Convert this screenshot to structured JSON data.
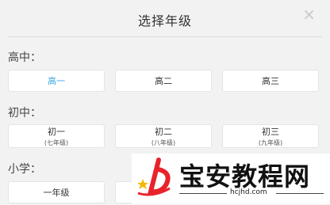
{
  "dialog": {
    "title": "选择年级",
    "close_glyph": "×"
  },
  "sections": {
    "high": {
      "label": "高中：",
      "options": [
        {
          "main": "高一",
          "selected": true
        },
        {
          "main": "高二"
        },
        {
          "main": "高三"
        }
      ]
    },
    "middle": {
      "label": "初中：",
      "options": [
        {
          "main": "初一",
          "sub": "(七年级)"
        },
        {
          "main": "初二",
          "sub": "(八年级)"
        },
        {
          "main": "初三",
          "sub": "(九年级)"
        }
      ]
    },
    "primary": {
      "label": "小学：",
      "options": [
        {
          "main": "一年级"
        }
      ]
    }
  },
  "watermark": {
    "text": "宝安教程网",
    "url": "hcjhd.com",
    "colors": {
      "logo_red": "#e8232c",
      "logo_star": "#f5b800"
    }
  },
  "colors": {
    "accent": "#3fa7e6",
    "background": "#f2f2f2"
  }
}
